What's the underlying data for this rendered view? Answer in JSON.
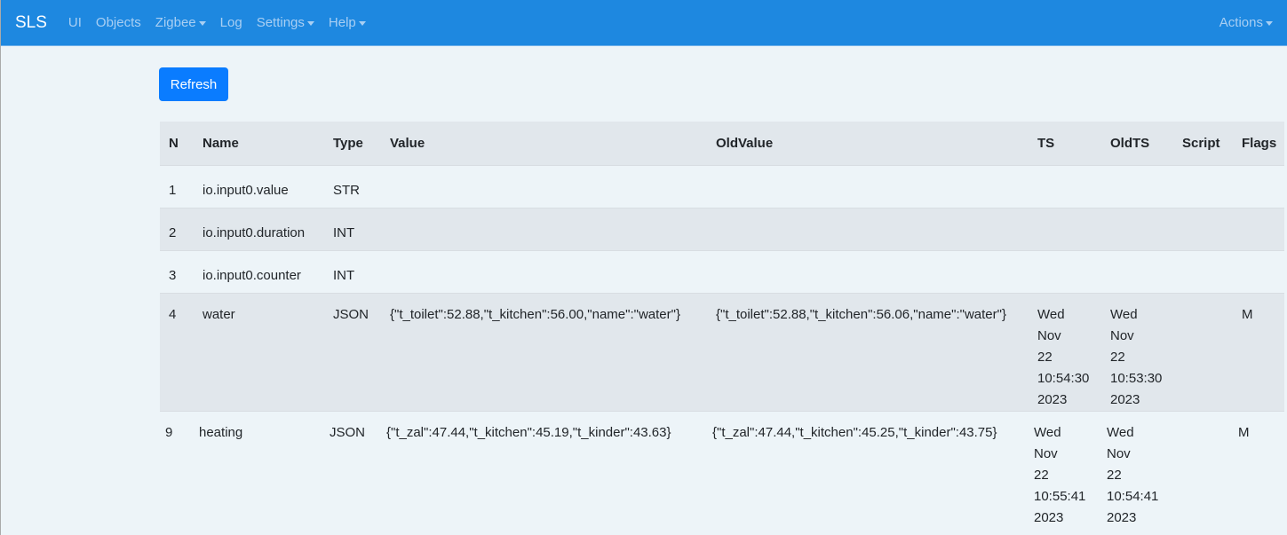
{
  "nav": {
    "brand": "SLS",
    "items": [
      "UI",
      "Objects",
      "Zigbee",
      "Log",
      "Settings",
      "Help"
    ],
    "actions": "Actions"
  },
  "refresh": "Refresh",
  "table": {
    "headers": [
      "N",
      "Name",
      "Type",
      "Value",
      "OldValue",
      "TS",
      "OldTS",
      "Script",
      "Flags"
    ],
    "rows": [
      [
        "1",
        "io.input0.value",
        "STR",
        "",
        "",
        "",
        "",
        "",
        ""
      ],
      [
        "2",
        "io.input0.duration",
        "INT",
        "",
        "",
        "",
        "",
        "",
        ""
      ],
      [
        "3",
        "io.input0.counter",
        "INT",
        "",
        "",
        "",
        "",
        "",
        ""
      ],
      [
        "4",
        "water",
        "JSON",
        "{\"t_toilet\":52.88,\"t_kitchen\":56.00,\"name\":\"water\"}",
        "{\"t_toilet\":52.88,\"t_kitchen\":56.06,\"name\":\"water\"}",
        "Wed Nov 22 10:54:30 2023",
        "Wed Nov 22 10:53:30 2023",
        "",
        "M"
      ],
      [
        "9",
        "heating",
        "JSON",
        "{\"t_zal\":47.44,\"t_kitchen\":45.19,\"t_kinder\":43.63}",
        "{\"t_zal\":47.44,\"t_kitchen\":45.25,\"t_kinder\":43.75}",
        "Wed Nov 22 10:55:41 2023",
        "Wed Nov 22 10:54:41 2023",
        "",
        "M"
      ]
    ]
  }
}
